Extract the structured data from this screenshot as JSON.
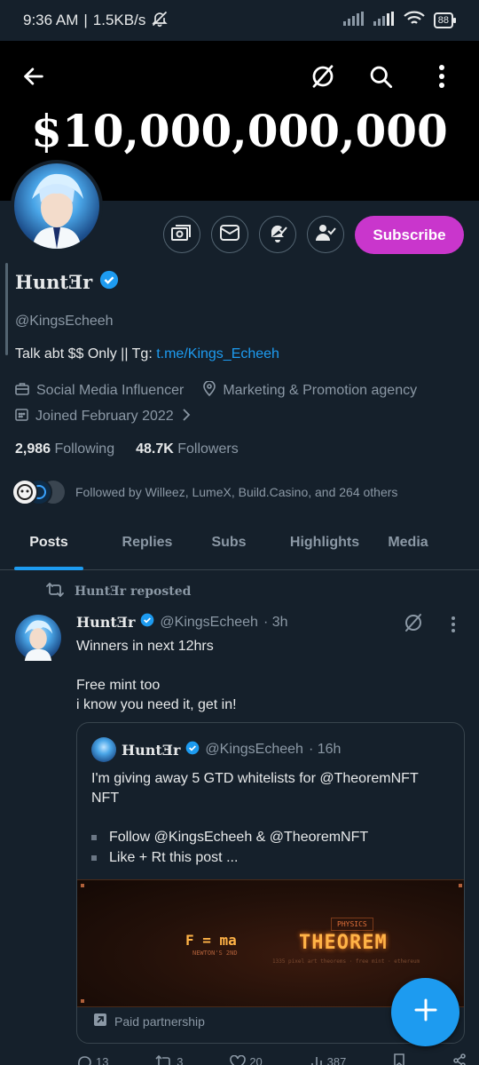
{
  "status_bar": {
    "time": "9:36 AM",
    "separator": "|",
    "speed": "1.5KB/s",
    "battery": "88"
  },
  "banner": {
    "title": "$10,000,000,000"
  },
  "profile": {
    "name": "HuntƎr",
    "handle": "@KingsEcheeh",
    "bio_prefix": "Talk abt $$ Only || Tg: ",
    "bio_link": "t.me/Kings_Echeeh",
    "category": "Social Media Influencer",
    "location": "Marketing & Promotion agency",
    "joined": "Joined February 2022",
    "following_count": "2,986",
    "following_label": "Following",
    "followers_count": "48.7K",
    "followers_label": "Followers",
    "followed_by": "Followed by Willeez, LumeX, Build.Casino, and 264 others",
    "subscribe_label": "Subscribe"
  },
  "tabs": [
    "Posts",
    "Replies",
    "Subs",
    "Highlights",
    "Media"
  ],
  "post": {
    "repost_label": "HuntƎr reposted",
    "author": "HuntƎr",
    "handle": "@KingsEcheeh",
    "time": "· 3h",
    "line1": "Winners in next 12hrs",
    "line2": "Free mint too",
    "line3": "i know you need it, get in!",
    "quote": {
      "author": "HuntƎr",
      "handle": "@KingsEcheeh",
      "time": "· 16h",
      "text1": "I'm giving away 5 GTD whitelists for @TheoremNFT",
      "text2": "NFT",
      "bullet1": "Follow @KingsEcheeh & @TheoremNFT",
      "bullet2": "Like + Rt this post ...",
      "media_tag": "PHYSICS",
      "media_formula": "F = ma",
      "media_formula_sub": "NEWTON'S 2ND",
      "media_title": "THEOREM",
      "media_sub": "1335 pixel art theorems · free mint · ethereum",
      "paid_label": "Paid partnership"
    },
    "stats": {
      "replies": "13",
      "reposts": "3",
      "likes": "20",
      "views": "387"
    }
  },
  "colors": {
    "background": "#15202b",
    "accent": "#1d9bf0",
    "subscribe": "#c936cc",
    "muted": "#8b98a5"
  }
}
